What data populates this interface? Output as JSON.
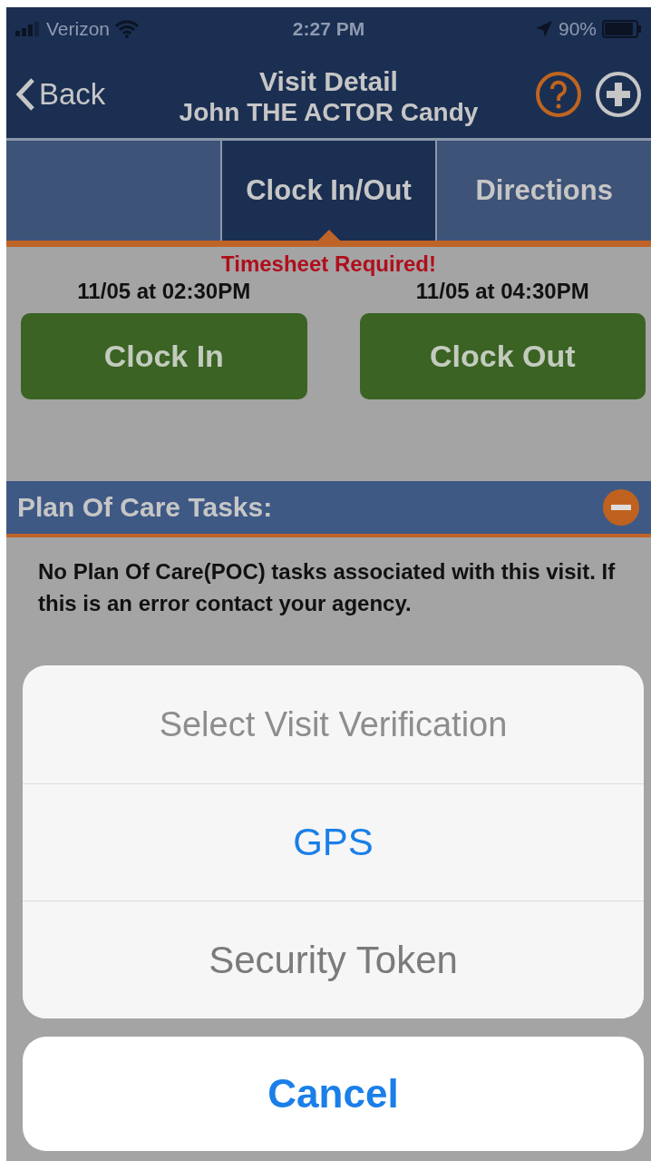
{
  "status_bar": {
    "carrier": "Verizon",
    "time": "2:27 PM",
    "battery": "90%"
  },
  "nav": {
    "back": "Back",
    "title": "Visit Detail",
    "subtitle": "John THE ACTOR Candy"
  },
  "tabs": [
    {
      "label": "Clock In/Out",
      "selected": true
    },
    {
      "label": "Directions",
      "selected": false
    }
  ],
  "alert": "Timesheet Required!",
  "clock": [
    {
      "time": "11/05 at 02:30PM",
      "button": "Clock In"
    },
    {
      "time": "11/05 at 04:30PM",
      "button": "Clock Out"
    }
  ],
  "plan_of_care": {
    "title": "Plan Of Care Tasks:",
    "message": "No Plan Of Care(POC) tasks associated with this visit. If this is an error contact your agency."
  },
  "action_sheet": {
    "title": "Select Visit Verification",
    "options": [
      {
        "label": "GPS",
        "disabled": false
      },
      {
        "label": "Security Token",
        "disabled": true
      }
    ],
    "cancel": "Cancel"
  }
}
